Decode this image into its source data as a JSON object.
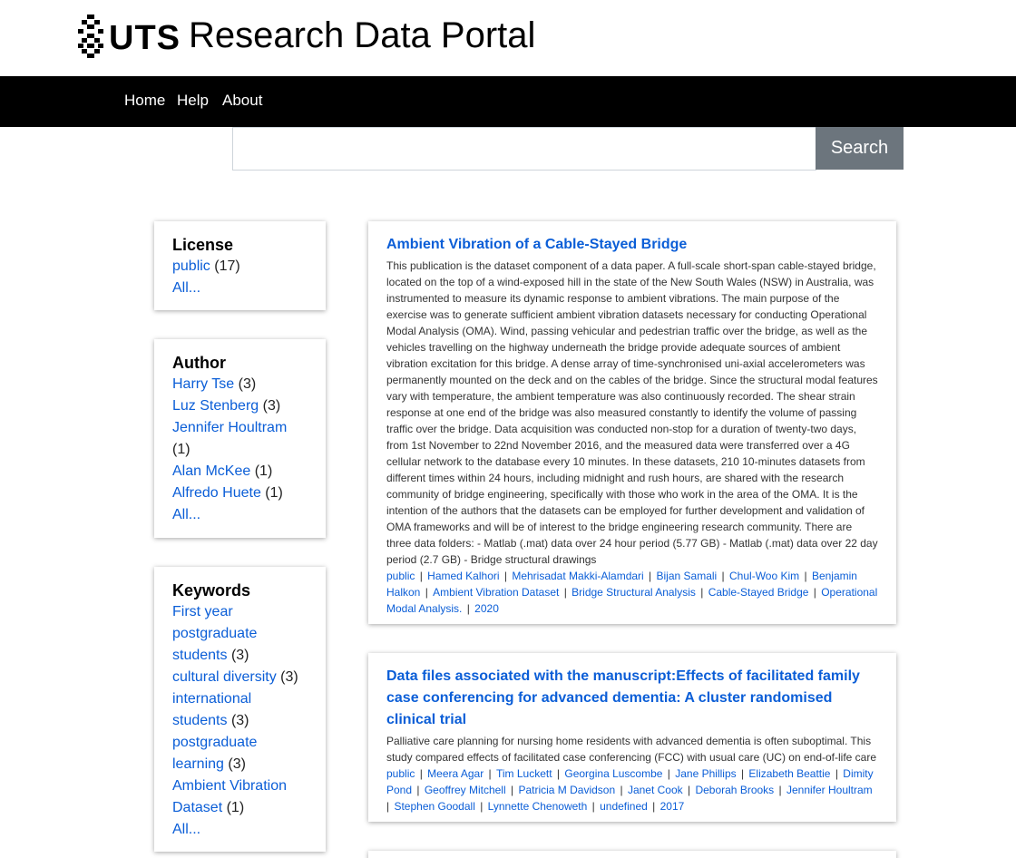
{
  "header": {
    "logo_text": "UTS",
    "site_title": "Research Data Portal"
  },
  "nav": {
    "items": [
      "Home",
      "Help",
      "About"
    ]
  },
  "search": {
    "placeholder": "",
    "value": "",
    "button_label": "Search"
  },
  "facets": {
    "license": {
      "title": "License",
      "items": [
        {
          "label": "public",
          "count": "(17)"
        }
      ],
      "all_label": "All..."
    },
    "author": {
      "title": "Author",
      "items": [
        {
          "label": "Harry Tse",
          "count": "(3)"
        },
        {
          "label": "Luz Stenberg",
          "count": "(3)"
        },
        {
          "label": "Jennifer Houltram",
          "count": "(1)"
        },
        {
          "label": "Alan McKee",
          "count": "(1)"
        },
        {
          "label": "Alfredo Huete",
          "count": "(1)"
        }
      ],
      "all_label": "All..."
    },
    "keywords": {
      "title": "Keywords",
      "items": [
        {
          "label": "First year postgraduate students",
          "count": "(3)"
        },
        {
          "label": "cultural diversity",
          "count": "(3)"
        },
        {
          "label": "international students",
          "count": "(3)"
        },
        {
          "label": "postgraduate learning",
          "count": "(3)"
        },
        {
          "label": "Ambient Vibration Dataset",
          "count": "(1)"
        }
      ],
      "all_label": "All..."
    }
  },
  "results": [
    {
      "title": "Ambient Vibration of a Cable-Stayed Bridge",
      "description": "This publication is the dataset component of a data paper. A full-scale short-span cable-stayed bridge, located on the top of a wind-exposed hill in the state of the New South Wales (NSW) in Australia, was instrumented to measure its dynamic response to ambient vibrations. The main purpose of the exercise was to generate sufficient ambient vibration datasets necessary for conducting Operational Modal Analysis (OMA). Wind, passing vehicular and pedestrian traffic over the bridge, as well as the vehicles travelling on the highway underneath the bridge provide adequate sources of ambient vibration excitation for this bridge. A dense array of time-synchronised uni-axial accelerometers was permanently mounted on the deck and on the cables of the bridge. Since the structural modal features vary with temperature, the ambient temperature was also continuously recorded. The shear strain response at one end of the bridge was also measured constantly to identify the volume of passing traffic over the bridge. Data acquisition was conducted non-stop for a duration of twenty-two days, from 1st November to 22nd November 2016, and the measured data were transferred over a 4G cellular network to the database every 10 minutes. In these datasets, 210 10-minutes datasets from different times within 24 hours, including midnight and rush hours, are shared with the research community of bridge engineering, specifically with those who work in the area of the OMA. It is the intention of the authors that the datasets can be employed for further development and validation of OMA frameworks and will be of interest to the bridge engineering research community. There are three data folders: - Matlab (.mat) data over 24 hour period (5.77 GB) - Matlab (.mat) data over 22 day period (2.7 GB) - Bridge structural drawings",
      "tags": [
        "public",
        "Hamed Kalhori",
        "Mehrisadat Makki-Alamdari",
        "Bijan Samali",
        "Chul-Woo Kim",
        "Benjamin Halkon",
        "Ambient Vibration Dataset",
        "Bridge Structural Analysis",
        "Cable-Stayed Bridge",
        "Operational Modal Analysis.",
        "2020"
      ]
    },
    {
      "title": "Data files associated with the manuscript:Effects of facilitated family case conferencing for advanced dementia: A cluster randomised clinical trial",
      "description": "Palliative care planning for nursing home residents with advanced dementia is often suboptimal. This study compared effects of facilitated case conferencing (FCC) with usual care (UC) on end-of-life care",
      "tags": [
        "public",
        "Meera Agar",
        "Tim Luckett",
        "Georgina Luscombe",
        "Jane Phillips",
        "Elizabeth Beattie",
        "Dimity Pond",
        "Geoffrey Mitchell",
        "Patricia M Davidson",
        "Janet Cook",
        "Deborah Brooks",
        "Jennifer Houltram",
        "Stephen Goodall",
        "Lynnette Chenoweth",
        "undefined",
        "2017"
      ]
    }
  ],
  "tag_separator": "|",
  "colors": {
    "navbar": "#000000",
    "link": "#0b5ed7",
    "search_button": "#6c757d"
  }
}
